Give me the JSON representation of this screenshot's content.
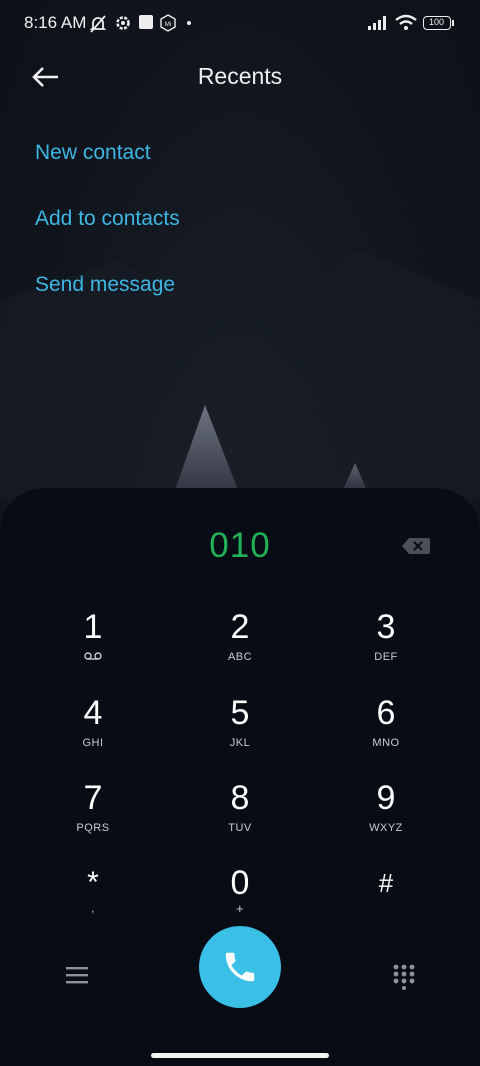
{
  "status_bar": {
    "time": "8:16 AM",
    "battery": "100",
    "icons": [
      "muted-bell-icon",
      "settings-gear-icon",
      "square-icon",
      "mi-icon",
      "dot-icon",
      "signal-icon",
      "wifi-icon",
      "battery-icon"
    ]
  },
  "header": {
    "title": "Recents",
    "back_icon": "arrow-left-icon"
  },
  "menu": {
    "new_contact": "New contact",
    "add_to_contacts": "Add to contacts",
    "send_message": "Send message"
  },
  "dialer": {
    "number": "010",
    "accent_color": "#3abfe6",
    "number_color": "#21b156",
    "keys": [
      {
        "digit": "1",
        "letters": ""
      },
      {
        "digit": "2",
        "letters": "ABC"
      },
      {
        "digit": "3",
        "letters": "DEF"
      },
      {
        "digit": "4",
        "letters": "GHI"
      },
      {
        "digit": "5",
        "letters": "JKL"
      },
      {
        "digit": "6",
        "letters": "MNO"
      },
      {
        "digit": "7",
        "letters": "PQRS"
      },
      {
        "digit": "8",
        "letters": "TUV"
      },
      {
        "digit": "9",
        "letters": "WXYZ"
      },
      {
        "digit": "*",
        "letters": ","
      },
      {
        "digit": "0",
        "letters": "+"
      },
      {
        "digit": "#",
        "letters": ""
      }
    ]
  }
}
